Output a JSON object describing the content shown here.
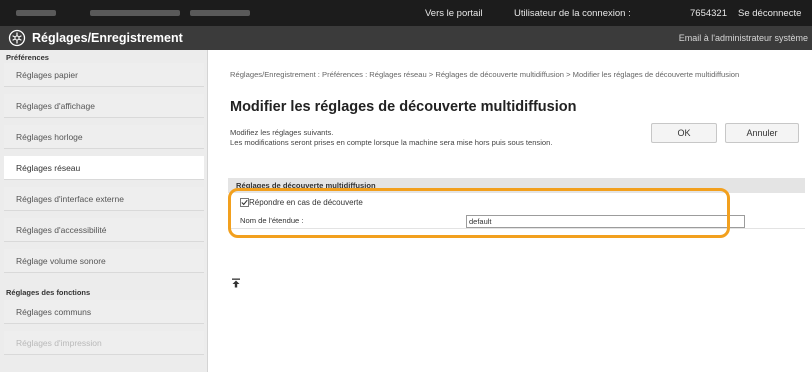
{
  "top_bar": {
    "portal_link": "Vers le portail",
    "user_label": "Utilisateur de la connexion :",
    "user_id": "7654321",
    "logout_link": "Se déconnecte"
  },
  "title_bar": {
    "title": "Réglages/Enregistrement",
    "admin_mail": "Email à l'administrateur système"
  },
  "sidebar": {
    "groups": [
      {
        "heading": "Préférences",
        "items": [
          {
            "label": "Réglages papier"
          },
          {
            "label": "Réglages d'affichage"
          },
          {
            "label": "Réglages horloge"
          },
          {
            "label": "Réglages réseau",
            "active": true
          },
          {
            "label": "Réglages d'interface externe"
          },
          {
            "label": "Réglages d'accessibilité"
          },
          {
            "label": "Réglage volume sonore"
          }
        ]
      },
      {
        "heading": "Réglages des fonctions",
        "items": [
          {
            "label": "Réglages communs"
          },
          {
            "label": "Réglages d'impression"
          }
        ]
      }
    ]
  },
  "main": {
    "breadcrumb": "Réglages/Enregistrement : Préférences : Réglages réseau > Réglages de découverte multidiffusion > Modifier les réglages de découverte multidiffusion",
    "page_title": "Modifier les réglages de découverte multidiffusion",
    "description": "Modifiez les réglages suivants.\nLes modifications seront prises en compte lorsque la machine sera mise hors puis sous tension.",
    "ok_label": "OK",
    "cancel_label": "Annuler",
    "section_title": "Réglages de découverte multidiffusion",
    "respond_checkbox": {
      "label": "Répondre en cas de découverte",
      "checked": true
    },
    "scope_name": {
      "label": "Nom de l'étendue :",
      "value": "default"
    }
  },
  "colors": {
    "highlight": "#f2a01e",
    "title_bar": "#3b3b3b",
    "top_bar": "#1c1c1c"
  }
}
